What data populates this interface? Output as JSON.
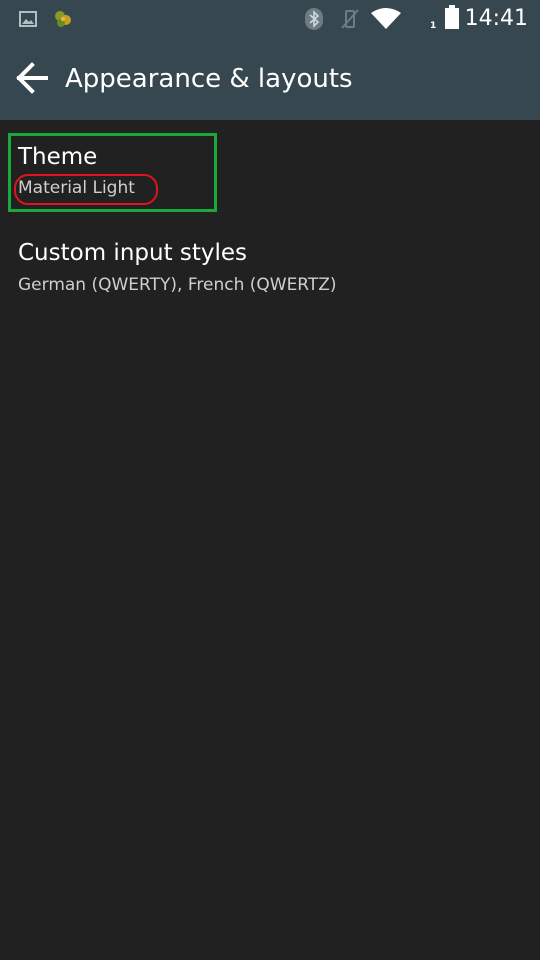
{
  "status_bar": {
    "time": "14:41",
    "sim_slot": "1",
    "icons": [
      "image-notification-icon",
      "app-notification-icon",
      "bluetooth-icon",
      "vibrate-off-icon",
      "wifi-icon",
      "signal-icon",
      "battery-icon"
    ]
  },
  "app_bar": {
    "back_icon": "arrow-left-icon",
    "title": "Appearance & layouts"
  },
  "preferences": [
    {
      "title": "Theme",
      "summary": "Material Light"
    },
    {
      "title": "Custom input styles",
      "summary": "German (QWERTY), French (QWERTZ)"
    }
  ],
  "colors": {
    "background": "#212121",
    "toolbar": "#37474f",
    "highlight_green": "#1aa83a",
    "highlight_red": "#e0141e"
  }
}
